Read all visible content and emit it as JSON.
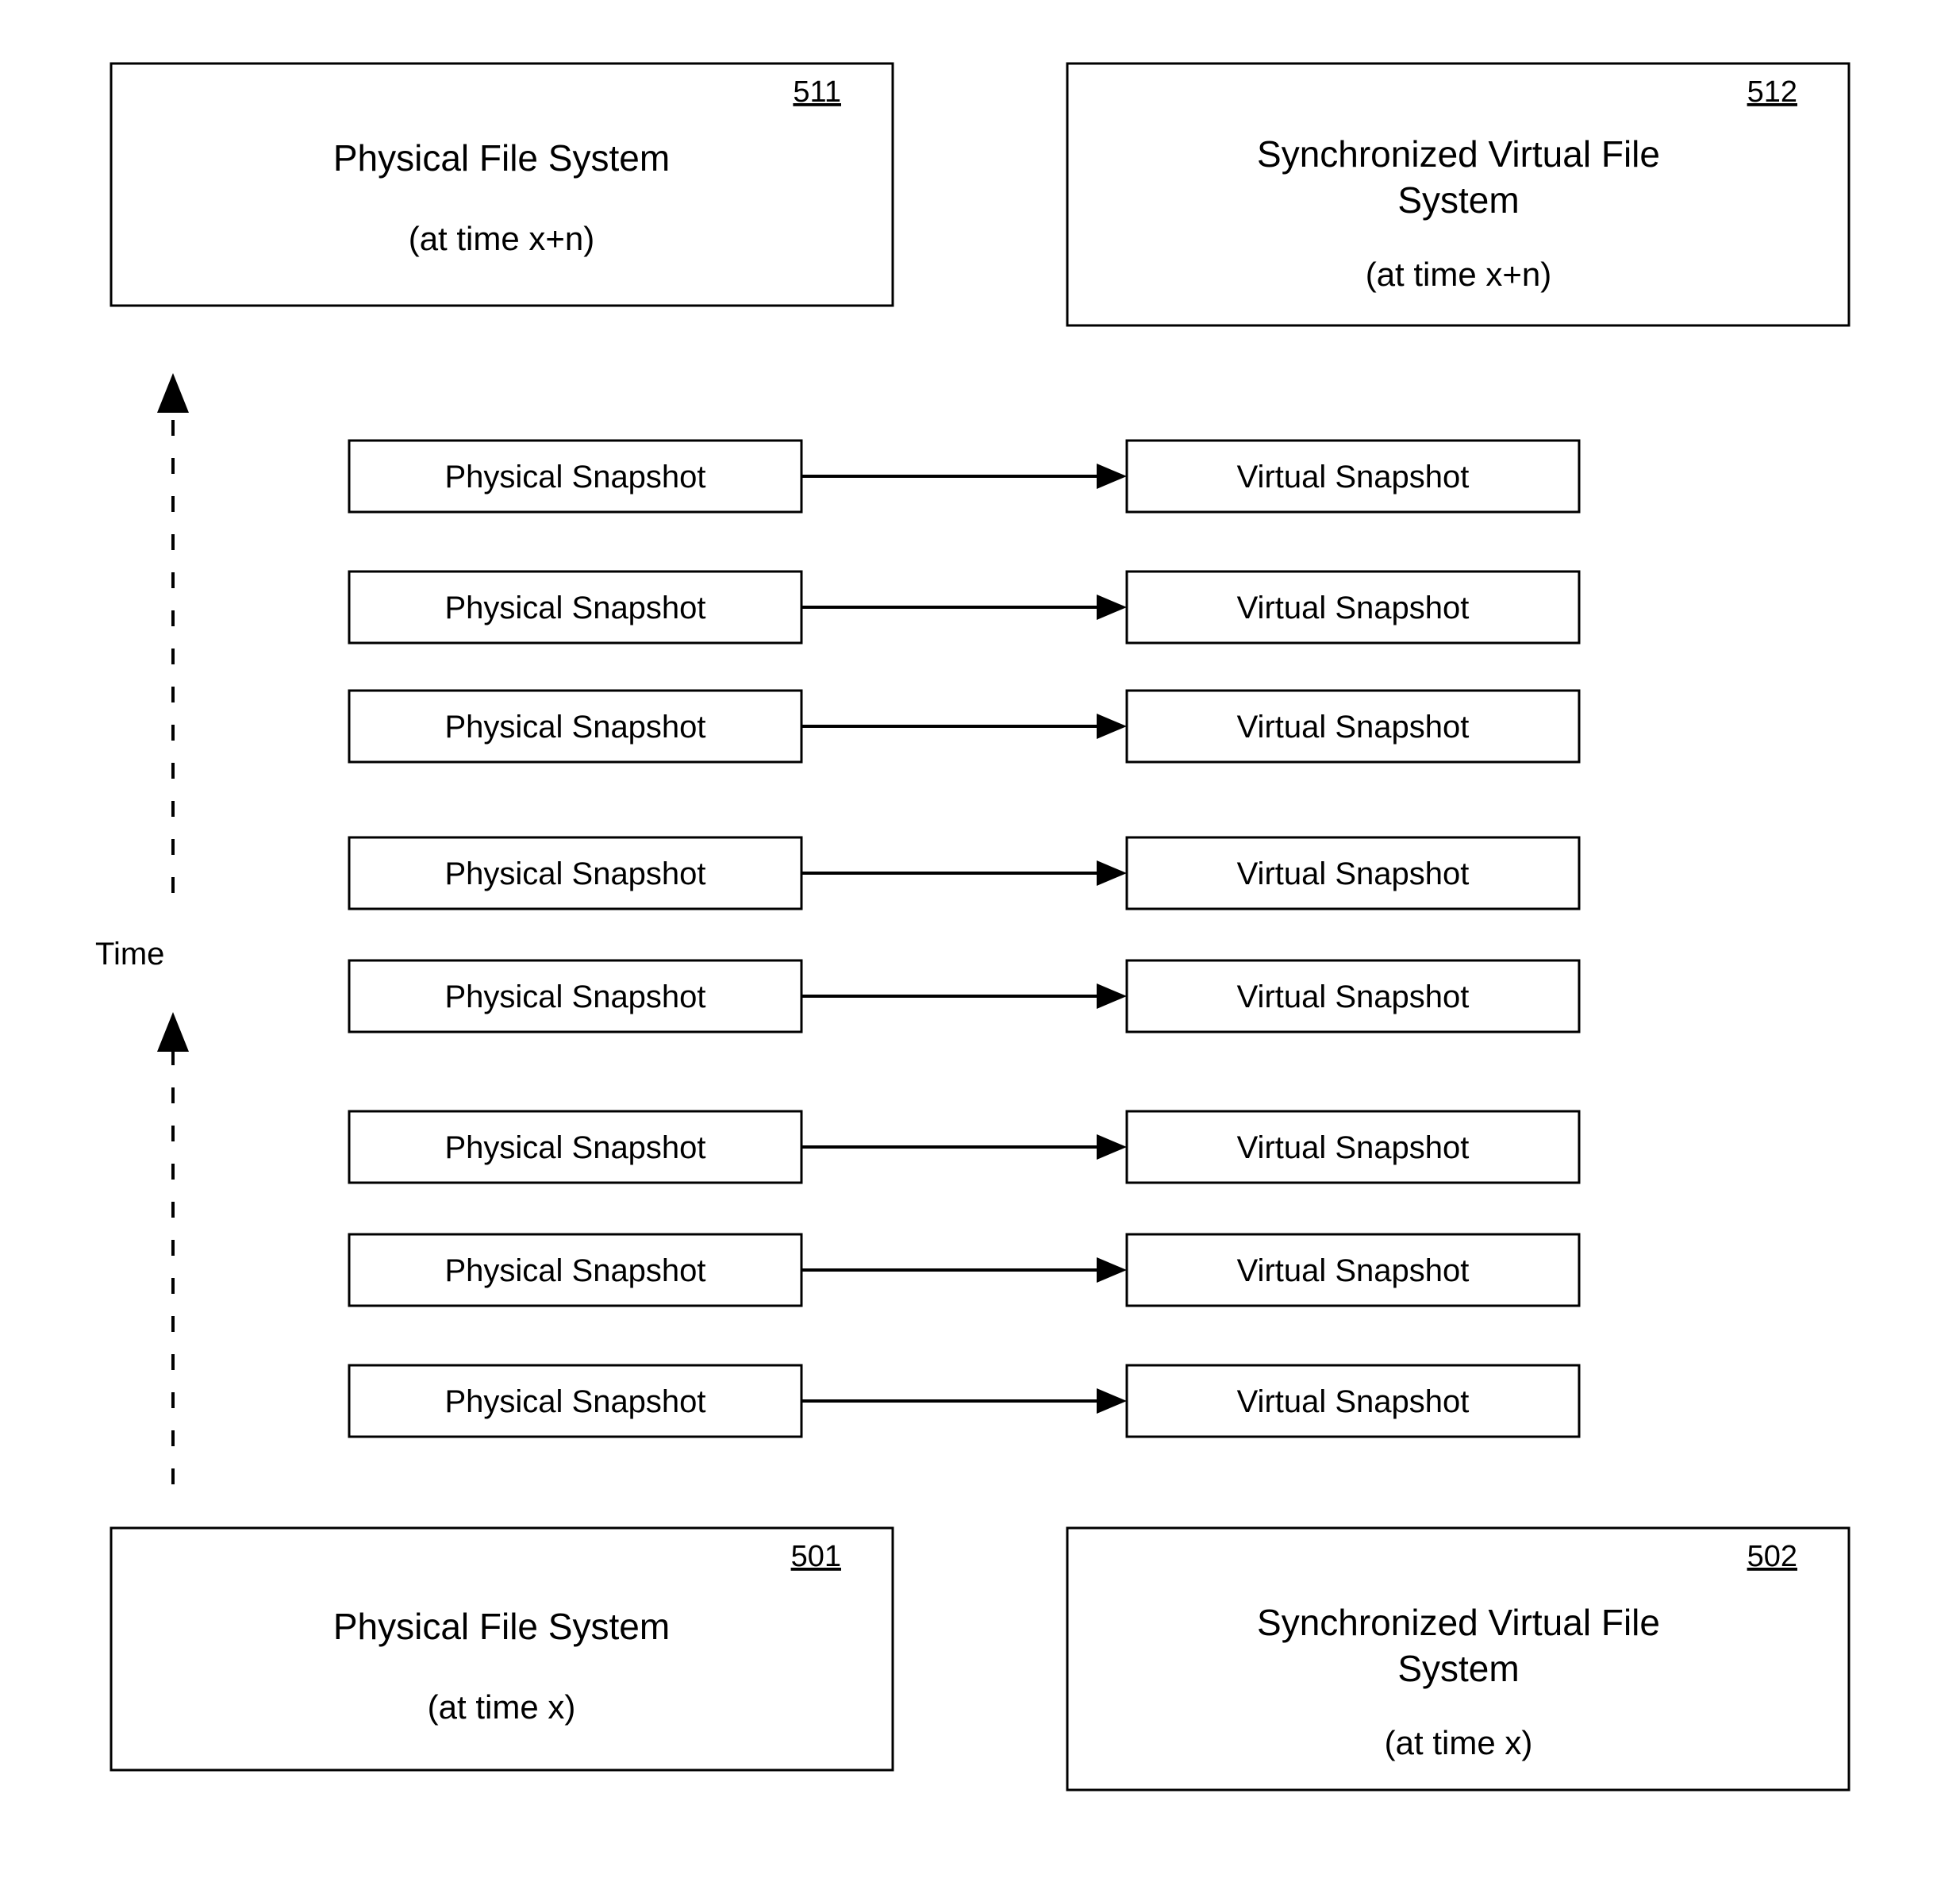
{
  "top_left": {
    "ref": "511",
    "line1": "Physical File System",
    "line2": "(at time x+n)"
  },
  "top_right": {
    "ref": "512",
    "line1": "Synchronized Virtual File",
    "line2": "System",
    "line3": "(at time x+n)"
  },
  "bottom_left": {
    "ref": "501",
    "line1": "Physical File System",
    "line2": "(at time x)"
  },
  "bottom_right": {
    "ref": "502",
    "line1": "Synchronized Virtual File",
    "line2": "System",
    "line3": "(at time x)"
  },
  "time_label": "Time",
  "snapshot_rows": [
    {
      "left": "Physical Snapshot",
      "right": "Virtual Snapshot"
    },
    {
      "left": "Physical Snapshot",
      "right": "Virtual Snapshot"
    },
    {
      "left": "Physical Snapshot",
      "right": "Virtual Snapshot"
    },
    {
      "left": "Physical Snapshot",
      "right": "Virtual Snapshot"
    },
    {
      "left": "Physical Snapshot",
      "right": "Virtual Snapshot"
    },
    {
      "left": "Physical Snapshot",
      "right": "Virtual Snapshot"
    },
    {
      "left": "Physical Snapshot",
      "right": "Virtual Snapshot"
    },
    {
      "left": "Physical Snapshot",
      "right": "Virtual Snapshot"
    }
  ]
}
